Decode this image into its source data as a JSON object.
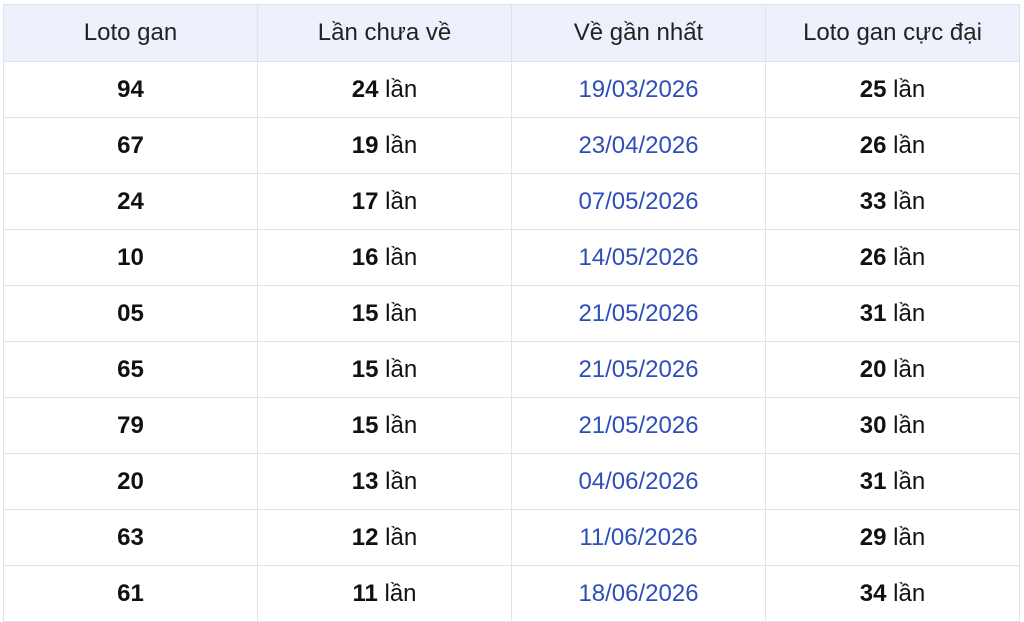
{
  "table": {
    "headers": [
      "Loto gan",
      "Lần chưa về",
      "Về gần nhất",
      "Loto gan cực đại"
    ],
    "unit": "lần",
    "rows": [
      {
        "loto": "94",
        "missed": "24",
        "last": "19/03/2026",
        "max": "25"
      },
      {
        "loto": "67",
        "missed": "19",
        "last": "23/04/2026",
        "max": "26"
      },
      {
        "loto": "24",
        "missed": "17",
        "last": "07/05/2026",
        "max": "33"
      },
      {
        "loto": "10",
        "missed": "16",
        "last": "14/05/2026",
        "max": "26"
      },
      {
        "loto": "05",
        "missed": "15",
        "last": "21/05/2026",
        "max": "31"
      },
      {
        "loto": "65",
        "missed": "15",
        "last": "21/05/2026",
        "max": "20"
      },
      {
        "loto": "79",
        "missed": "15",
        "last": "21/05/2026",
        "max": "30"
      },
      {
        "loto": "20",
        "missed": "13",
        "last": "04/06/2026",
        "max": "31"
      },
      {
        "loto": "63",
        "missed": "12",
        "last": "11/06/2026",
        "max": "29"
      },
      {
        "loto": "61",
        "missed": "11",
        "last": "18/06/2026",
        "max": "34"
      }
    ]
  },
  "colors": {
    "header_bg": "#ecf1fb",
    "border": "#dde3ee",
    "date_text": "#2e4fb8",
    "text": "#111111"
  }
}
